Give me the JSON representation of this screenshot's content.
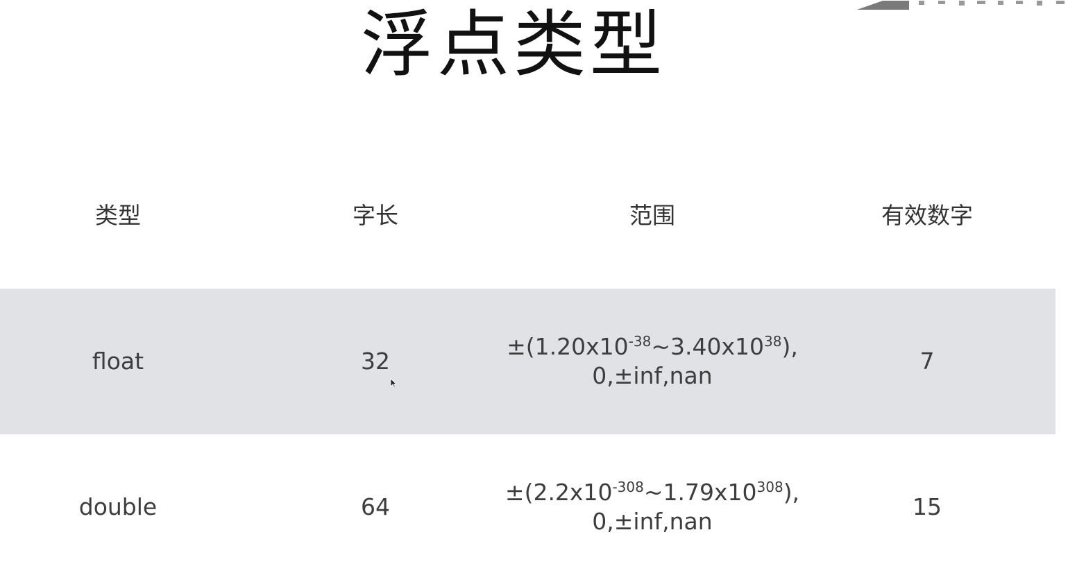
{
  "slide": {
    "title": "浮点类型"
  },
  "table": {
    "headers": [
      "类型",
      "字长",
      "范围",
      "有效数字"
    ],
    "rows": [
      {
        "type": "float",
        "bits": "32",
        "range": {
          "prefix": "±(1.20x10",
          "exp1": "-38",
          "mid": "~3.40x10",
          "exp2": "38",
          "suffix": "),",
          "line2": "0,±inf,nan"
        },
        "digits": "7"
      },
      {
        "type": "double",
        "bits": "64",
        "range": {
          "prefix": "±(2.2x10",
          "exp1": "-308",
          "mid": "~1.79x10",
          "exp2": "308",
          "suffix": "),",
          "line2": "0,±inf,nan"
        },
        "digits": "15"
      }
    ]
  },
  "colors": {
    "highlight_row": "#e1e2e6",
    "text": "#3d3d3d",
    "title": "#111111",
    "logo": "#7a7a7a"
  },
  "icons": {
    "logo": "corner-logo-icon",
    "cursor": "mouse-pointer-icon"
  }
}
